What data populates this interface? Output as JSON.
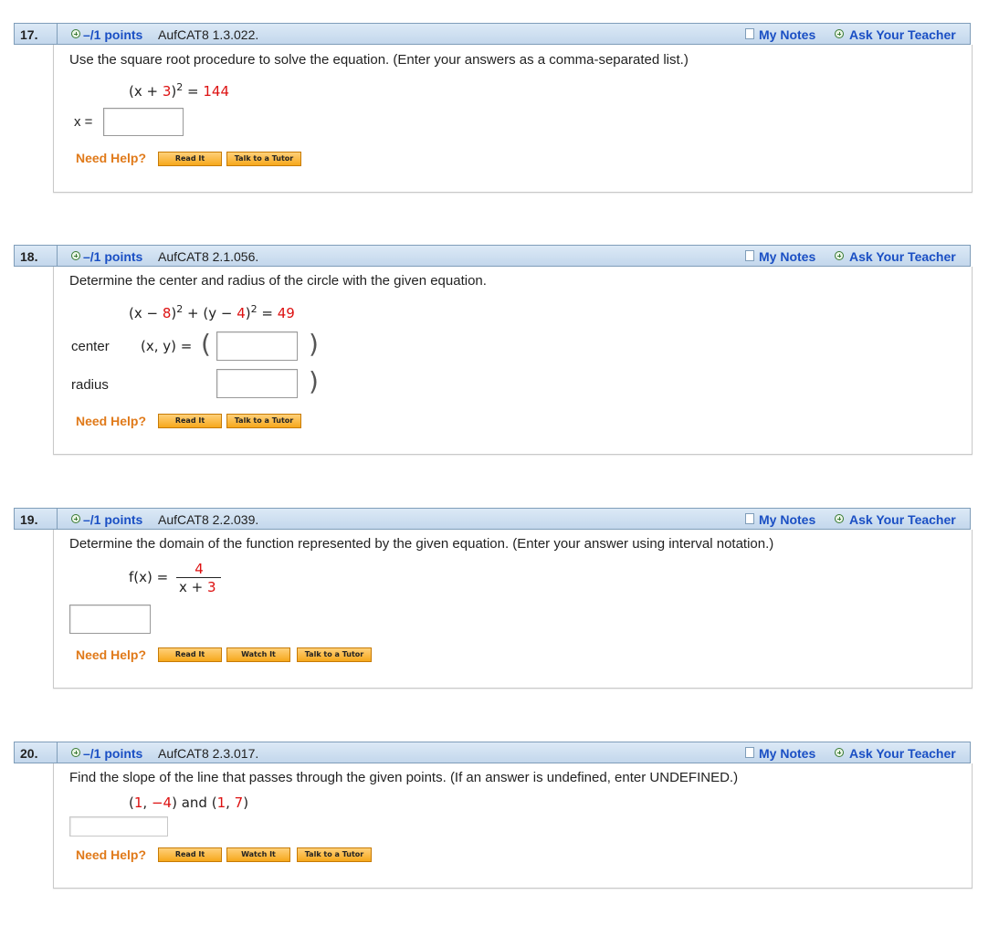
{
  "header_common": {
    "points": "–/1 points",
    "my_notes": "My Notes",
    "ask_teacher": "Ask Your Teacher"
  },
  "help": {
    "need_help": "Need Help?",
    "read_it": "Read It",
    "watch_it": "Watch It",
    "talk_tutor": "Talk to a Tutor"
  },
  "q17": {
    "num": "17.",
    "code": "AufCAT8 1.3.022.",
    "prompt": "Use the square root procedure to solve the equation. (Enter your answers as a comma-separated list.)",
    "eq_a": "(x + ",
    "eq_b": "3",
    "eq_c": ")",
    "eq_exp": "2",
    "eq_d": " = ",
    "eq_e": "144",
    "answer_label": "x ="
  },
  "q18": {
    "num": "18.",
    "code": "AufCAT8 2.1.056.",
    "prompt": "Determine the center and radius of the circle with the given equation.",
    "eq_a": "(x − ",
    "eq_b": "8",
    "eq_c": ")",
    "eq_exp1": "2",
    "eq_d": " + (y − ",
    "eq_e": "4",
    "eq_f": ")",
    "eq_exp2": "2",
    "eq_g": " = ",
    "eq_h": "49",
    "center_label": "center",
    "xy_label": "(x, y) =",
    "radius_label": "radius"
  },
  "q19": {
    "num": "19.",
    "code": "AufCAT8 2.2.039.",
    "prompt": "Determine the domain of the function represented by the given equation. (Enter your answer using interval notation.)",
    "func_label": "f(x) =",
    "numerator": "4",
    "denom_a": "x + ",
    "denom_b": "3"
  },
  "q20": {
    "num": "20.",
    "code": "AufCAT8 2.3.017.",
    "prompt": "Find the slope of the line that passes through the given points. (If an answer is undefined, enter UNDEFINED.)",
    "p1_open": "(",
    "p1_x": "1",
    "p1_comma": ", ",
    "p1_y": "−4",
    "p1_close": ")",
    "and": " and ",
    "p2_open": "(",
    "p2_x": "1",
    "p2_comma": ", ",
    "p2_y": "7",
    "p2_close": ")"
  }
}
